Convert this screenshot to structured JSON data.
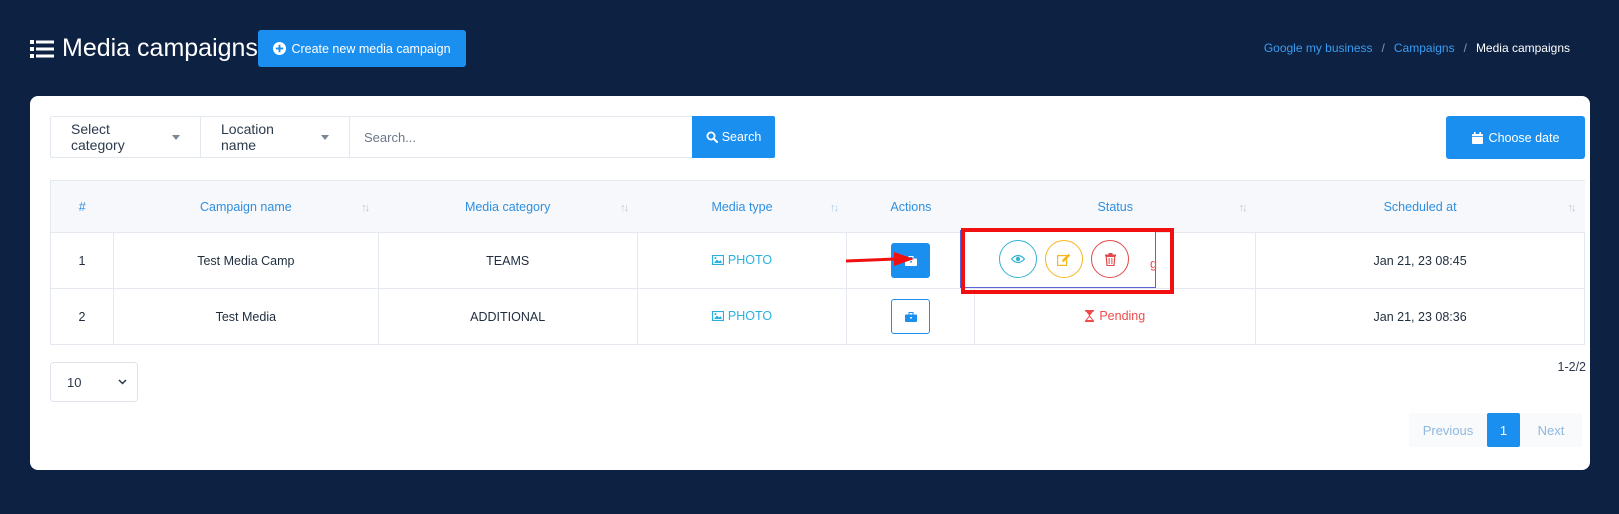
{
  "header": {
    "title": "Media campaigns",
    "create_label": "Create new media campaign"
  },
  "breadcrumb": {
    "items": [
      "Google my business",
      "Campaigns"
    ],
    "current": "Media campaigns"
  },
  "filters": {
    "category_label": "Select category",
    "location_label": "Location name",
    "search_placeholder": "Search...",
    "search_value": "",
    "search_label": "Search",
    "date_label": "Choose date"
  },
  "table": {
    "columns": [
      "#",
      "Campaign name",
      "Media category",
      "Media type",
      "Actions",
      "Status",
      "Scheduled at"
    ],
    "rows": [
      {
        "num": "1",
        "name": "Test Media Camp",
        "category": "TEAMS",
        "type": "PHOTO",
        "status": "Pending",
        "scheduled": "Jan 21, 23 08:45"
      },
      {
        "num": "2",
        "name": "Test Media",
        "category": "ADDITIONAL",
        "type": "PHOTO",
        "status": "Pending",
        "scheduled": "Jan 21, 23 08:36"
      }
    ]
  },
  "popover": {
    "peek_text": "g"
  },
  "footer": {
    "page_size": "10",
    "range": "1-2/2",
    "prev_label": "Previous",
    "current_page": "1",
    "next_label": "Next"
  },
  "colors": {
    "background": "#0d2142",
    "primary": "#1b8fef",
    "pending": "#ef4a4a",
    "view": "#35b3d1",
    "edit": "#f4b820",
    "delete": "#e14a4a",
    "highlight": "#f01010"
  }
}
